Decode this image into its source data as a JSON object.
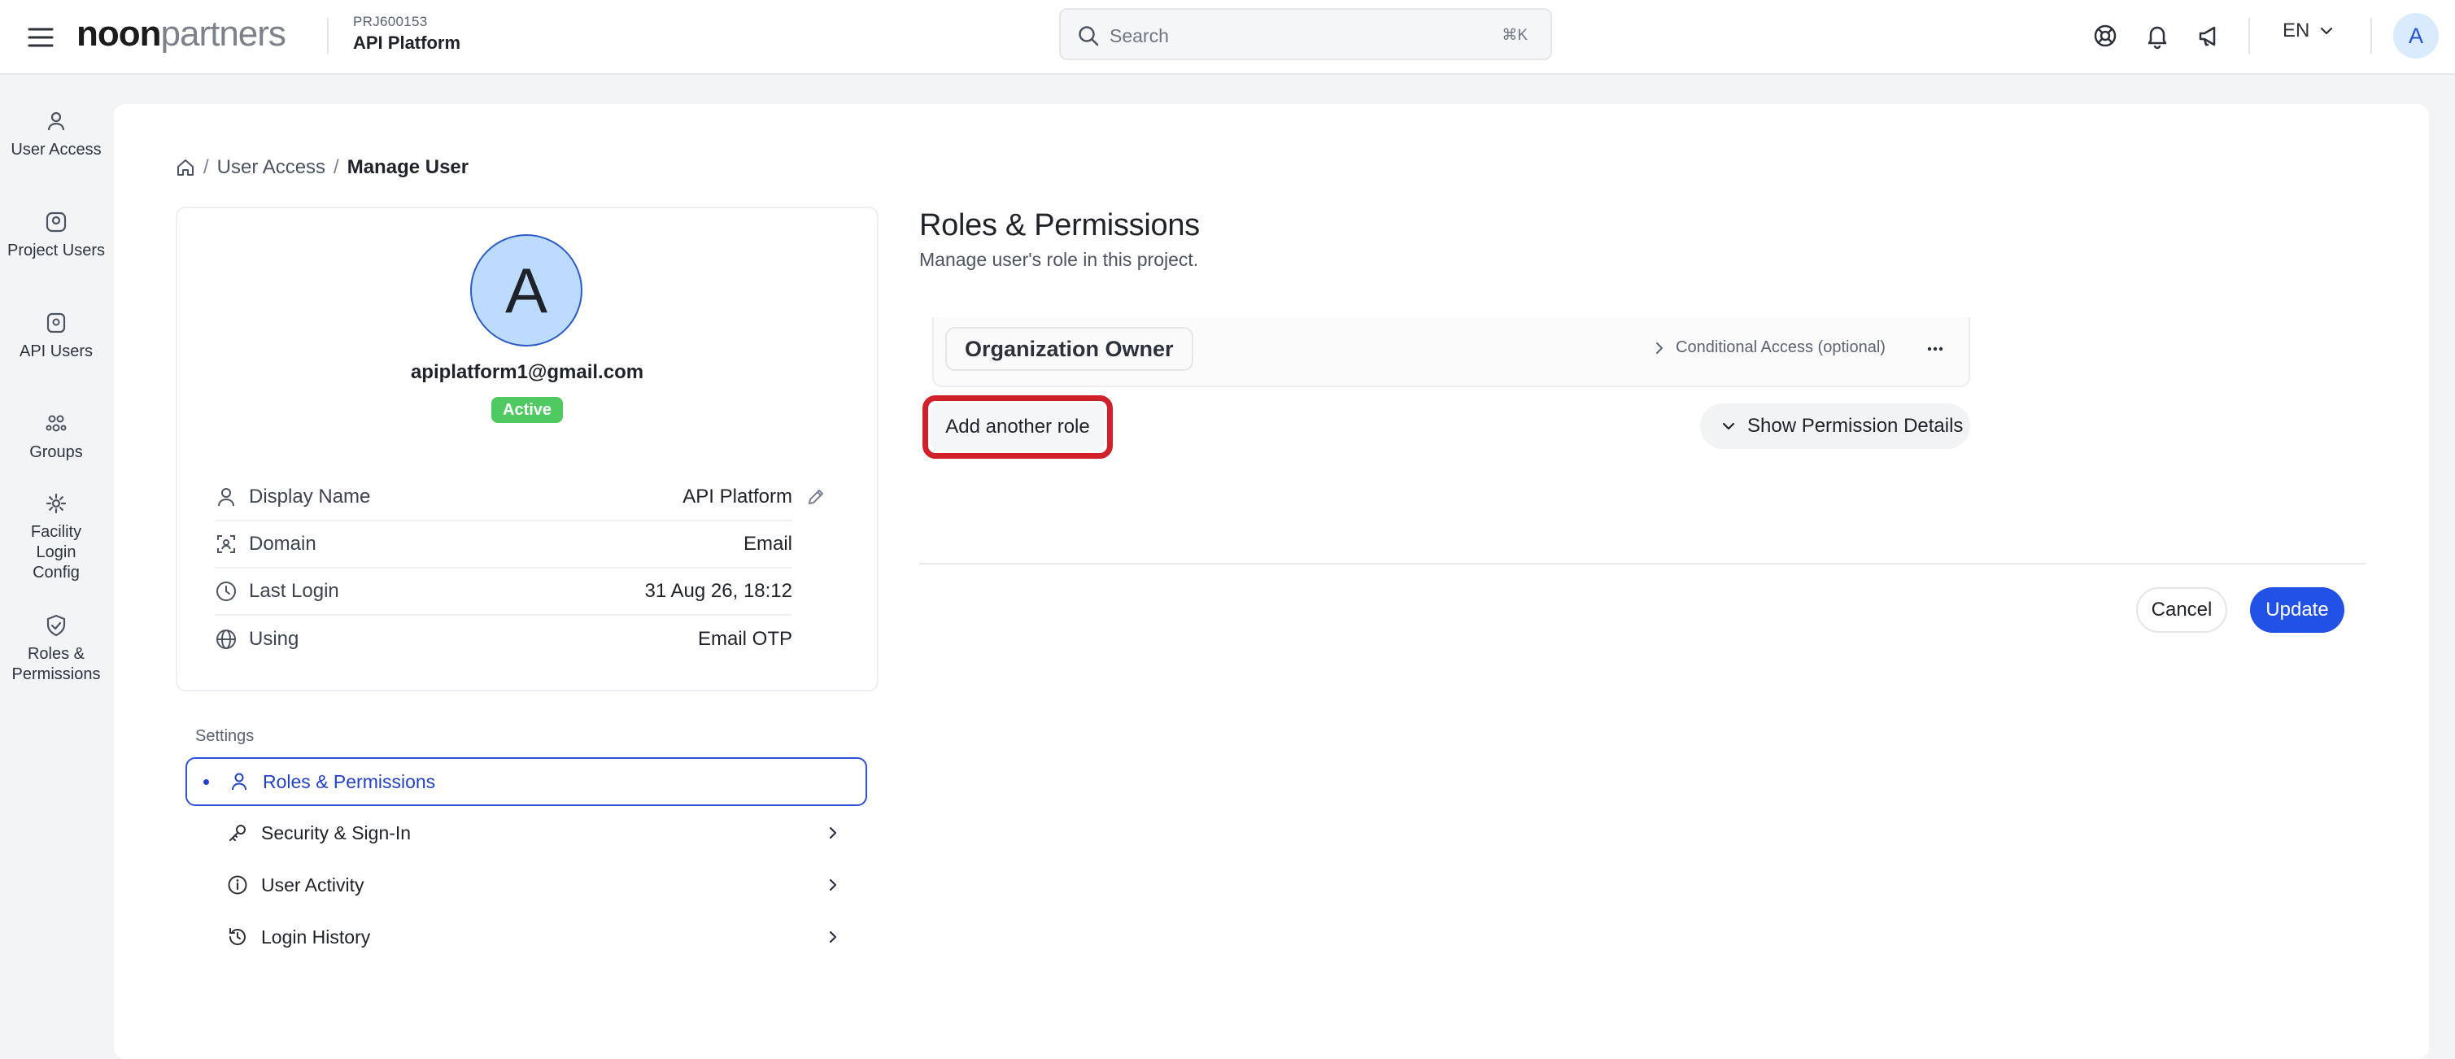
{
  "app": {
    "logo_primary": "noon",
    "logo_secondary": "partners",
    "project_code": "PRJ600153",
    "project_name": "API Platform"
  },
  "search": {
    "placeholder": "Search",
    "shortcut": "⌘K"
  },
  "header": {
    "language": "EN",
    "avatar_initial": "A"
  },
  "sidebar": {
    "items": [
      {
        "label": "User Access",
        "icon": "user-icon"
      },
      {
        "label": "Project Users",
        "icon": "user-circle-icon"
      },
      {
        "label": "API Users",
        "icon": "api-icon"
      },
      {
        "label": "Groups",
        "icon": "groups-icon"
      },
      {
        "label": "Facility Login Config",
        "icon": "gear-icon"
      },
      {
        "label": "Roles & Permissions",
        "icon": "shield-check-icon"
      }
    ]
  },
  "breadcrumb": {
    "items": [
      "User Access",
      "Manage User"
    ]
  },
  "profile": {
    "avatar_initial": "A",
    "email": "apiplatform1@gmail.com",
    "status": "Active",
    "fields": [
      {
        "label": "Display Name",
        "value": "API Platform"
      },
      {
        "label": "Domain",
        "value": "Email"
      },
      {
        "label": "Last Login",
        "value": "31 Aug 26, 18:12"
      },
      {
        "label": "Using",
        "value": "Email OTP"
      }
    ]
  },
  "settings": {
    "heading": "Settings",
    "items": [
      {
        "label": "Roles & Permissions",
        "active": true
      },
      {
        "label": "Security & Sign-In",
        "active": false
      },
      {
        "label": "User Activity",
        "active": false
      },
      {
        "label": "Login History",
        "active": false
      }
    ]
  },
  "roles": {
    "title": "Roles & Permissions",
    "subtitle": "Manage user's role in this project.",
    "role_name": "Organization Owner",
    "conditional_access": "Conditional Access (optional)",
    "add_role": "Add another role",
    "show_permissions": "Show Permission Details",
    "cancel": "Cancel",
    "update": "Update"
  },
  "colors": {
    "accent": "#2251e6",
    "status_active": "#4fca63",
    "highlight": "#d0202a"
  }
}
